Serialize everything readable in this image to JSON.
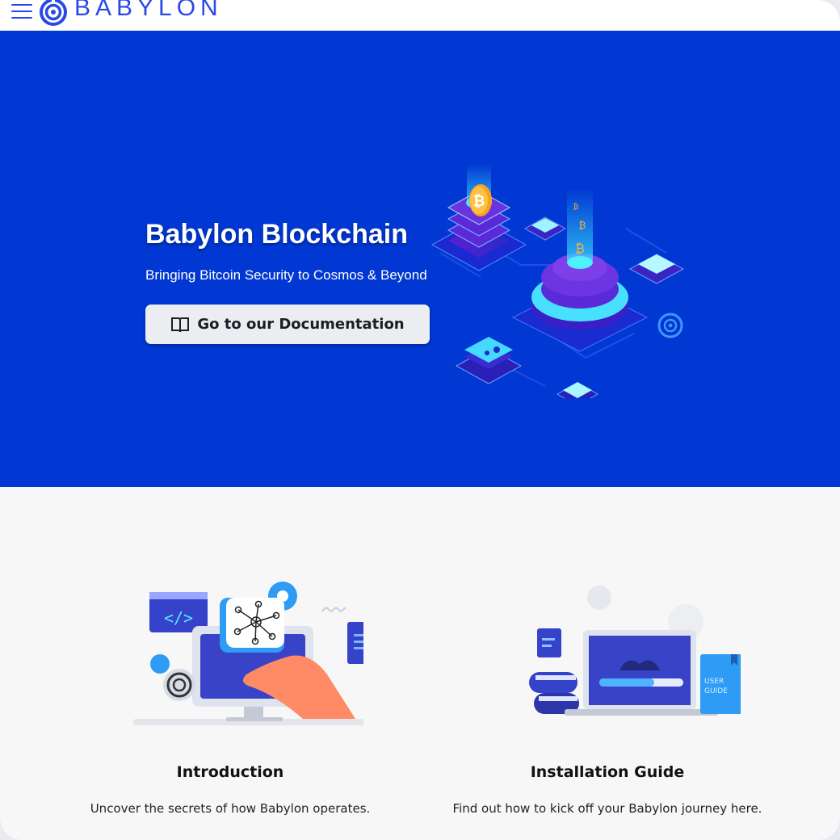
{
  "navbar": {
    "brand": "BABYLON",
    "menu_icon": "hamburger-icon",
    "logo_icon": "babylon-logo-icon"
  },
  "hero": {
    "title": "Babylon Blockchain",
    "subtitle": "Bringing Bitcoin Security to Cosmos & Beyond",
    "button_label": "Go to our Documentation",
    "button_icon": "book-icon",
    "background_color": "#0137d2"
  },
  "cards": [
    {
      "title": "Introduction",
      "description": "Uncover the secrets of how Babylon operates.",
      "illustration": "developer-network-illustration"
    },
    {
      "title": "Installation Guide",
      "description": "Find out how to kick off your Babylon journey here.",
      "illustration": "laptop-user-guide-illustration",
      "badge": "USER GUIDE"
    }
  ],
  "colors": {
    "accent": "#2a48e6",
    "hero_bg": "#0137d2",
    "page_bg": "#f7f7f8"
  }
}
